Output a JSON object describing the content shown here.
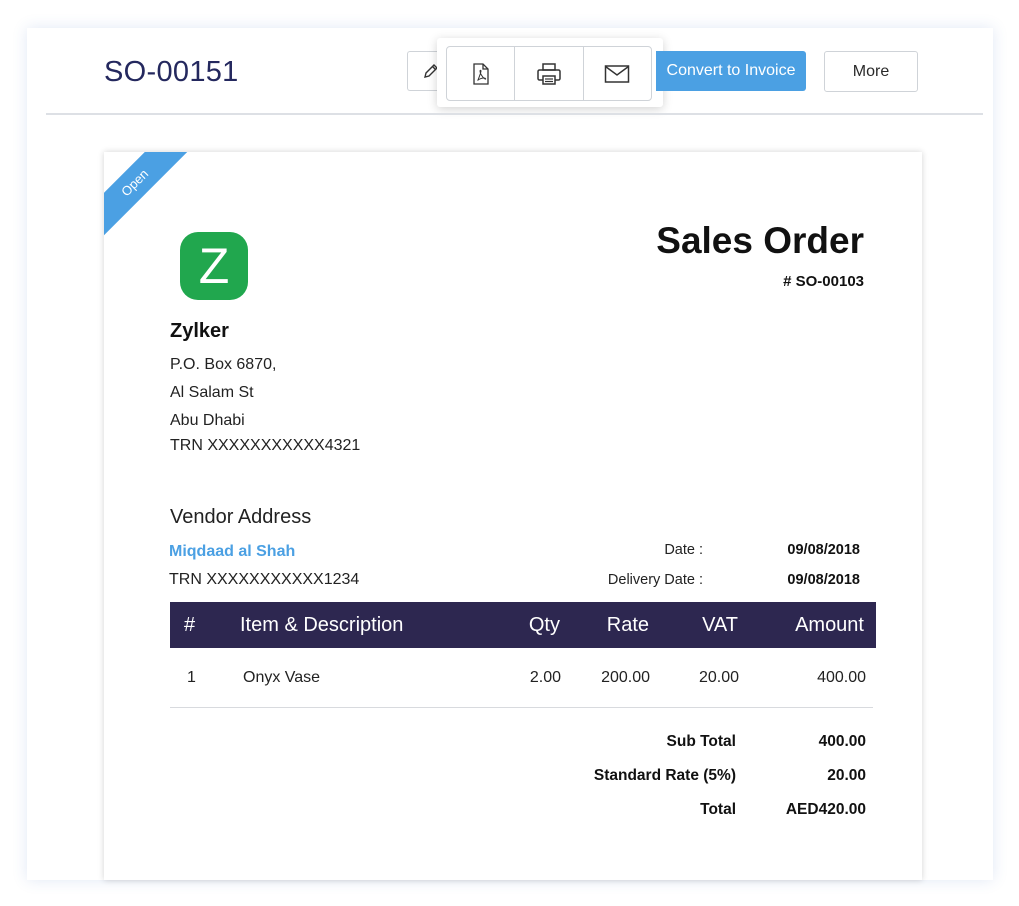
{
  "header": {
    "title": "SO-00151",
    "convert_label": "Convert to Invoice",
    "more_label": "More"
  },
  "status_ribbon": "Open",
  "document": {
    "heading": "Sales Order",
    "number": "# SO-00103",
    "logo_letter": "Z",
    "company": {
      "name": "Zylker",
      "address_lines": [
        "P.O. Box 6870,",
        "Al Salam St",
        "Abu Dhabi",
        "TRN XXXXXXXXXXX4321"
      ]
    },
    "vendor": {
      "section_title": "Vendor Address",
      "name": "Miqdaad al Shah",
      "trn": "TRN XXXXXXXXXXX1234"
    },
    "meta": [
      {
        "label": "Date :",
        "value": "09/08/2018"
      },
      {
        "label": "Delivery Date :",
        "value": "09/08/2018"
      }
    ],
    "table": {
      "columns": [
        "#",
        "Item & Description",
        "Qty",
        "Rate",
        "VAT",
        "Amount"
      ],
      "rows": [
        [
          "1",
          "Onyx Vase",
          "2.00",
          "200.00",
          "20.00",
          "400.00"
        ]
      ]
    },
    "totals": [
      {
        "label": "Sub Total",
        "value": "400.00"
      },
      {
        "label": "Standard Rate (5%)",
        "value": "20.00"
      },
      {
        "label": "Total",
        "value": "AED420.00"
      }
    ]
  },
  "colors": {
    "accent": "#4ba0e3",
    "table_header": "#2d2750",
    "logo": "#21a74e",
    "title_text": "#24285e"
  },
  "icons": [
    "pencil-icon",
    "pdf-icon",
    "print-icon",
    "mail-icon"
  ]
}
